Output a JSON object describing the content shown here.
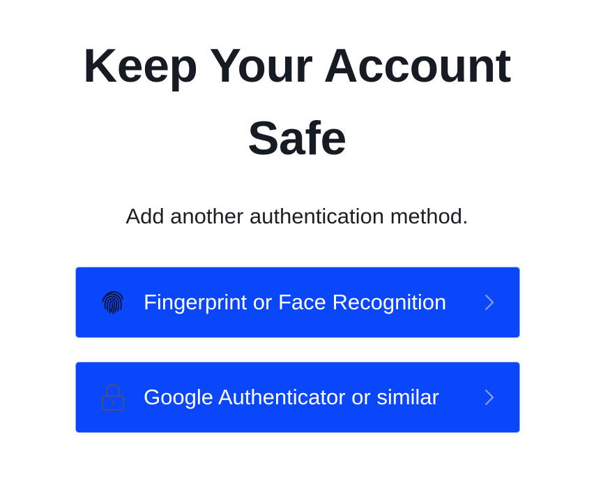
{
  "header": {
    "title_line1": "Keep Your Account",
    "title_line2": "Safe",
    "subtitle": "Add another authentication method."
  },
  "options": [
    {
      "label": "Fingerprint or Face Recognition",
      "icon": "fingerprint-icon"
    },
    {
      "label": "Google Authenticator or similar",
      "icon": "lock-icon"
    }
  ],
  "colors": {
    "button_background": "#0a46fa",
    "button_text": "#ffffff",
    "title_text": "#171b24",
    "chevron": "#8ea6ef"
  }
}
